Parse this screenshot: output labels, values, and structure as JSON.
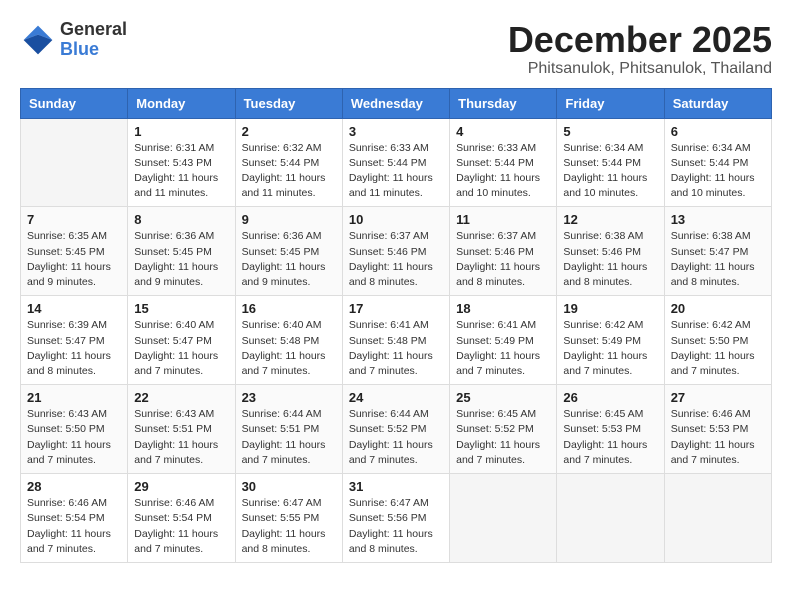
{
  "header": {
    "logo_general": "General",
    "logo_blue": "Blue",
    "month_title": "December 2025",
    "location": "Phitsanulok, Phitsanulok, Thailand"
  },
  "weekdays": [
    "Sunday",
    "Monday",
    "Tuesday",
    "Wednesday",
    "Thursday",
    "Friday",
    "Saturday"
  ],
  "weeks": [
    [
      {
        "day": "",
        "info": ""
      },
      {
        "day": "1",
        "info": "Sunrise: 6:31 AM\nSunset: 5:43 PM\nDaylight: 11 hours\nand 11 minutes."
      },
      {
        "day": "2",
        "info": "Sunrise: 6:32 AM\nSunset: 5:44 PM\nDaylight: 11 hours\nand 11 minutes."
      },
      {
        "day": "3",
        "info": "Sunrise: 6:33 AM\nSunset: 5:44 PM\nDaylight: 11 hours\nand 11 minutes."
      },
      {
        "day": "4",
        "info": "Sunrise: 6:33 AM\nSunset: 5:44 PM\nDaylight: 11 hours\nand 10 minutes."
      },
      {
        "day": "5",
        "info": "Sunrise: 6:34 AM\nSunset: 5:44 PM\nDaylight: 11 hours\nand 10 minutes."
      },
      {
        "day": "6",
        "info": "Sunrise: 6:34 AM\nSunset: 5:44 PM\nDaylight: 11 hours\nand 10 minutes."
      }
    ],
    [
      {
        "day": "7",
        "info": "Sunrise: 6:35 AM\nSunset: 5:45 PM\nDaylight: 11 hours\nand 9 minutes."
      },
      {
        "day": "8",
        "info": "Sunrise: 6:36 AM\nSunset: 5:45 PM\nDaylight: 11 hours\nand 9 minutes."
      },
      {
        "day": "9",
        "info": "Sunrise: 6:36 AM\nSunset: 5:45 PM\nDaylight: 11 hours\nand 9 minutes."
      },
      {
        "day": "10",
        "info": "Sunrise: 6:37 AM\nSunset: 5:46 PM\nDaylight: 11 hours\nand 8 minutes."
      },
      {
        "day": "11",
        "info": "Sunrise: 6:37 AM\nSunset: 5:46 PM\nDaylight: 11 hours\nand 8 minutes."
      },
      {
        "day": "12",
        "info": "Sunrise: 6:38 AM\nSunset: 5:46 PM\nDaylight: 11 hours\nand 8 minutes."
      },
      {
        "day": "13",
        "info": "Sunrise: 6:38 AM\nSunset: 5:47 PM\nDaylight: 11 hours\nand 8 minutes."
      }
    ],
    [
      {
        "day": "14",
        "info": "Sunrise: 6:39 AM\nSunset: 5:47 PM\nDaylight: 11 hours\nand 8 minutes."
      },
      {
        "day": "15",
        "info": "Sunrise: 6:40 AM\nSunset: 5:47 PM\nDaylight: 11 hours\nand 7 minutes."
      },
      {
        "day": "16",
        "info": "Sunrise: 6:40 AM\nSunset: 5:48 PM\nDaylight: 11 hours\nand 7 minutes."
      },
      {
        "day": "17",
        "info": "Sunrise: 6:41 AM\nSunset: 5:48 PM\nDaylight: 11 hours\nand 7 minutes."
      },
      {
        "day": "18",
        "info": "Sunrise: 6:41 AM\nSunset: 5:49 PM\nDaylight: 11 hours\nand 7 minutes."
      },
      {
        "day": "19",
        "info": "Sunrise: 6:42 AM\nSunset: 5:49 PM\nDaylight: 11 hours\nand 7 minutes."
      },
      {
        "day": "20",
        "info": "Sunrise: 6:42 AM\nSunset: 5:50 PM\nDaylight: 11 hours\nand 7 minutes."
      }
    ],
    [
      {
        "day": "21",
        "info": "Sunrise: 6:43 AM\nSunset: 5:50 PM\nDaylight: 11 hours\nand 7 minutes."
      },
      {
        "day": "22",
        "info": "Sunrise: 6:43 AM\nSunset: 5:51 PM\nDaylight: 11 hours\nand 7 minutes."
      },
      {
        "day": "23",
        "info": "Sunrise: 6:44 AM\nSunset: 5:51 PM\nDaylight: 11 hours\nand 7 minutes."
      },
      {
        "day": "24",
        "info": "Sunrise: 6:44 AM\nSunset: 5:52 PM\nDaylight: 11 hours\nand 7 minutes."
      },
      {
        "day": "25",
        "info": "Sunrise: 6:45 AM\nSunset: 5:52 PM\nDaylight: 11 hours\nand 7 minutes."
      },
      {
        "day": "26",
        "info": "Sunrise: 6:45 AM\nSunset: 5:53 PM\nDaylight: 11 hours\nand 7 minutes."
      },
      {
        "day": "27",
        "info": "Sunrise: 6:46 AM\nSunset: 5:53 PM\nDaylight: 11 hours\nand 7 minutes."
      }
    ],
    [
      {
        "day": "28",
        "info": "Sunrise: 6:46 AM\nSunset: 5:54 PM\nDaylight: 11 hours\nand 7 minutes."
      },
      {
        "day": "29",
        "info": "Sunrise: 6:46 AM\nSunset: 5:54 PM\nDaylight: 11 hours\nand 7 minutes."
      },
      {
        "day": "30",
        "info": "Sunrise: 6:47 AM\nSunset: 5:55 PM\nDaylight: 11 hours\nand 8 minutes."
      },
      {
        "day": "31",
        "info": "Sunrise: 6:47 AM\nSunset: 5:56 PM\nDaylight: 11 hours\nand 8 minutes."
      },
      {
        "day": "",
        "info": ""
      },
      {
        "day": "",
        "info": ""
      },
      {
        "day": "",
        "info": ""
      }
    ]
  ]
}
